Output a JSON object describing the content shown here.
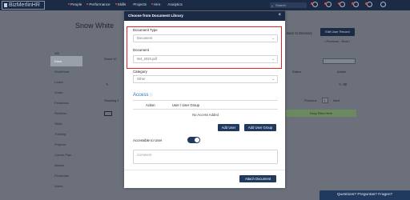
{
  "app": {
    "logo": "BizMerlinHR",
    "nav": [
      "People",
      "Performance",
      "Skills",
      "Projects",
      "Hire",
      "Analytics"
    ],
    "search_placeholder": "Search"
  },
  "profile": {
    "name": "Snow White",
    "id_label": "#86",
    "back_link": "Back to Directory",
    "edit_button": "Edit User Record",
    "prev_next": "‹ Previous - Next ›"
  },
  "sidebar": {
    "items": [
      {
        "label": "Docs",
        "active": true
      },
      {
        "label": "Workflows",
        "active": false
      },
      {
        "label": "Leave",
        "active": false
      },
      {
        "label": "Goals",
        "active": false
      },
      {
        "label": "Feedback",
        "active": false
      },
      {
        "label": "Reviews",
        "active": false
      },
      {
        "label": "Skills",
        "active": false
      },
      {
        "label": "Training",
        "active": false
      },
      {
        "label": "Projects",
        "active": false
      },
      {
        "label": "Career Plan",
        "active": false
      },
      {
        "label": "Assets",
        "active": false
      },
      {
        "label": "Financials",
        "active": false
      },
      {
        "label": "Notes",
        "active": false
      }
    ]
  },
  "background_page": {
    "show_label": "Show",
    "show_value": "10",
    "showing_label": "Showing 1",
    "table_headers": {
      "status": "Status",
      "action": "Action"
    },
    "pager": {
      "previous": "Previous",
      "page": "1",
      "next": "Next"
    },
    "drop_zone": "Drop Files Here"
  },
  "modal": {
    "title": "Choose from Document Library",
    "close": "×",
    "document_type_label": "Document Type",
    "document_type_value": "Document",
    "document_label": "Document",
    "document_value": "W4_2020.pdf",
    "category_label": "Category",
    "category_value": "Other",
    "access_title": "Access",
    "access_columns": {
      "action": "Action",
      "user_group": "User / User Group"
    },
    "access_empty": "No Access Added",
    "add_user_button": "Add User",
    "add_group_button": "Add User Group",
    "accessible_label": "Accessible to User",
    "accessible_on": true,
    "comment_placeholder": "Comment",
    "attach_button": "Attach Document"
  },
  "help_button": "Questions? Preguntas? Fragen?",
  "colors": {
    "navy": "#1c2b45",
    "button": "#1f3a5e",
    "highlight": "#e0222a",
    "access_blue": "#2f6db0"
  }
}
